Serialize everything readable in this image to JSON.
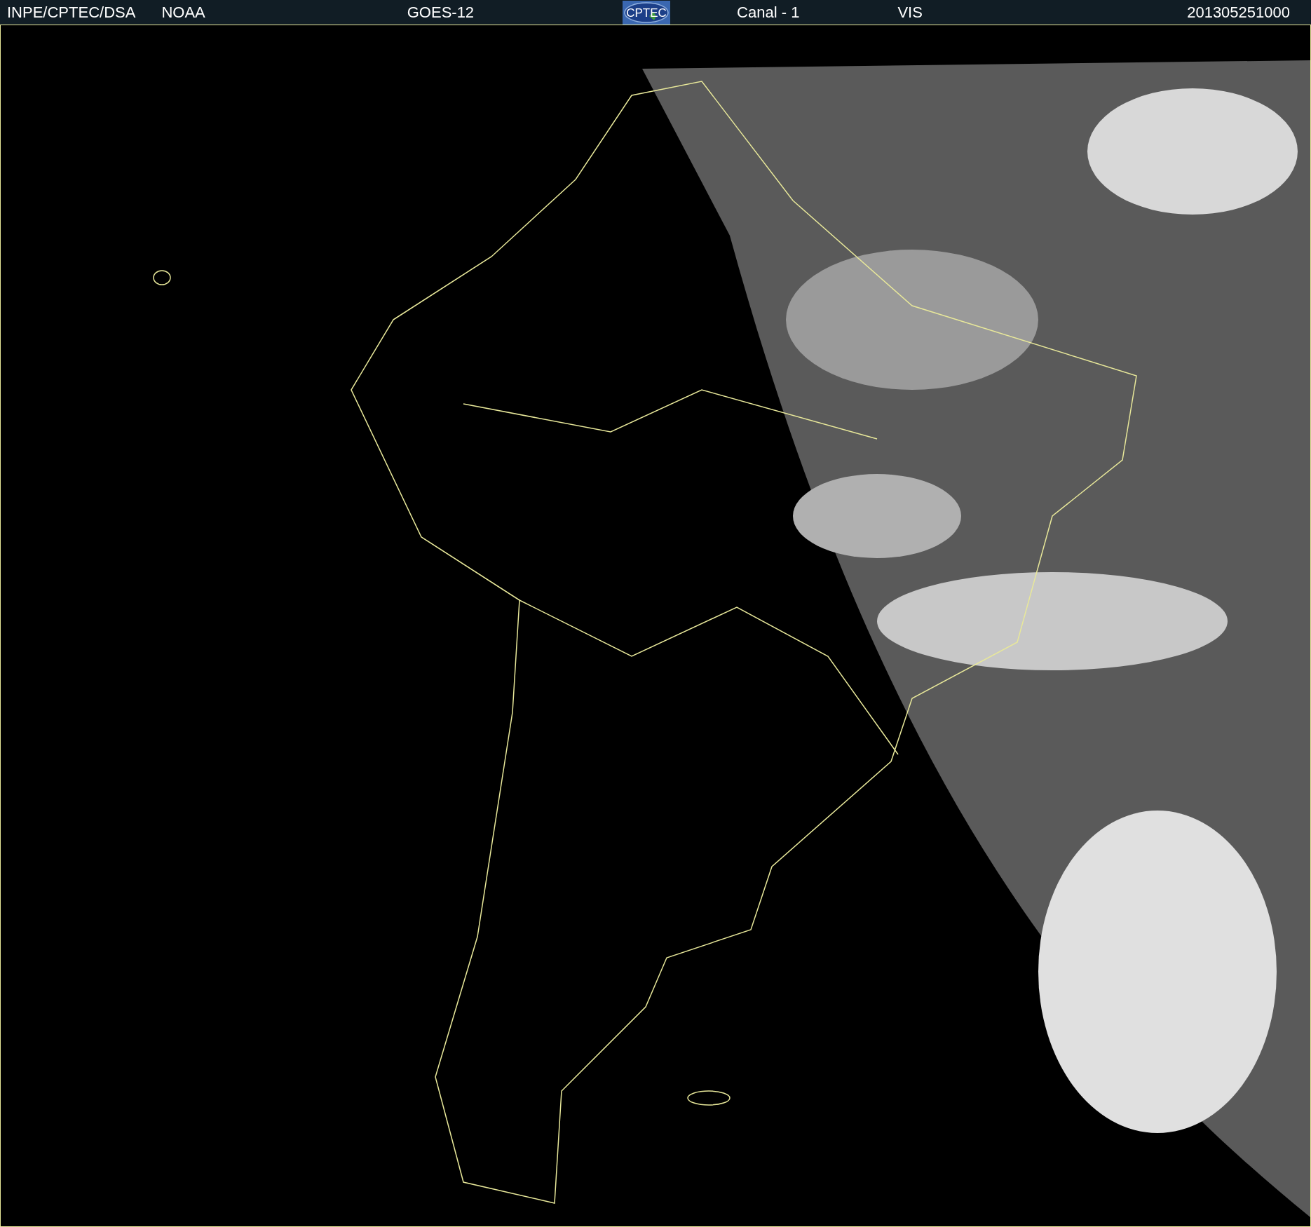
{
  "header": {
    "source": "INPE/CPTEC/DSA",
    "agency": "NOAA",
    "satellite": "GOES-12",
    "logo": "CPTEC",
    "channel": "Canal - 1",
    "band": "VIS",
    "timestamp": "201305251000"
  }
}
